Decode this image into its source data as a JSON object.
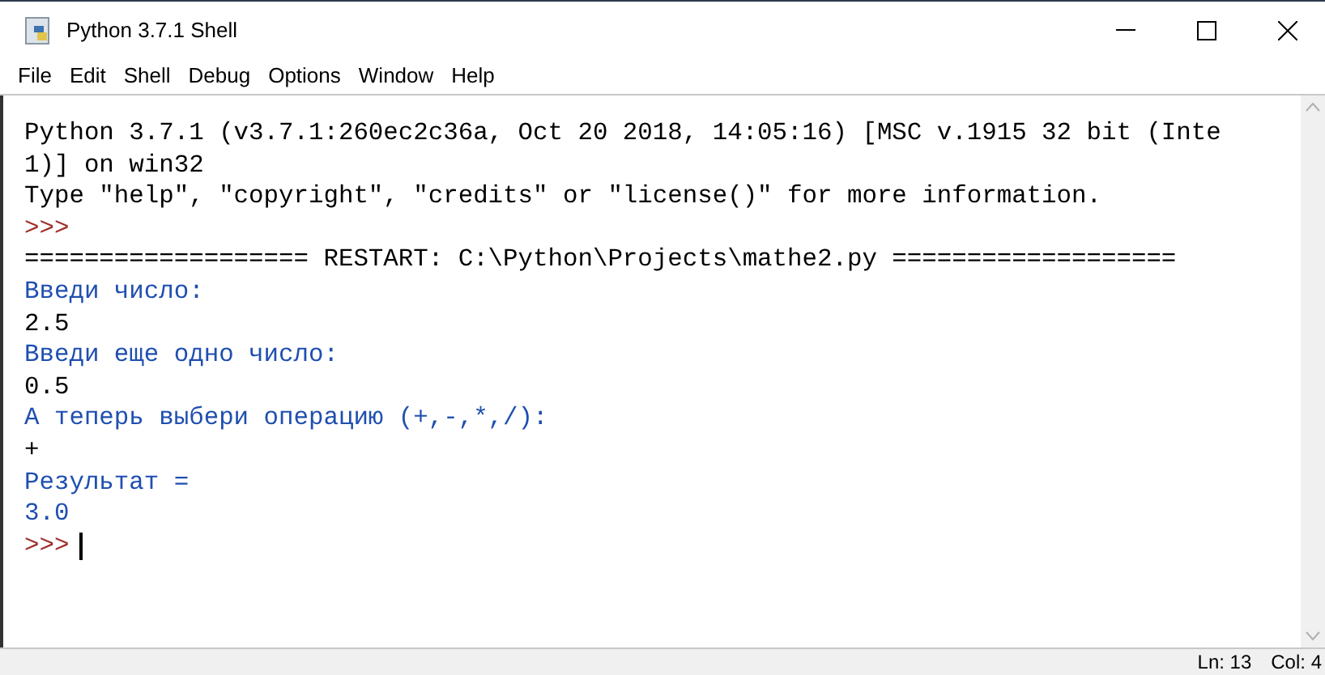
{
  "window": {
    "title": "Python 3.7.1 Shell"
  },
  "menu": [
    "File",
    "Edit",
    "Shell",
    "Debug",
    "Options",
    "Window",
    "Help"
  ],
  "lines": [
    {
      "kind": "output",
      "text": "Python 3.7.1 (v3.7.1:260ec2c36a, Oct 20 2018, 14:05:16) [MSC v.1915 32 bit (Inte"
    },
    {
      "kind": "output",
      "text": "1)] on win32"
    },
    {
      "kind": "output",
      "text": "Type \"help\", \"copyright\", \"credits\" or \"license()\" for more information."
    },
    {
      "kind": "prompt",
      "text": ">>>"
    },
    {
      "kind": "output",
      "text": "=================== RESTART: C:\\Python\\Projects\\mathe2.py ==================="
    },
    {
      "kind": "program",
      "text": "Введи число:"
    },
    {
      "kind": "input",
      "text": "2.5"
    },
    {
      "kind": "program",
      "text": "Введи еще одно число:"
    },
    {
      "kind": "input",
      "text": "0.5"
    },
    {
      "kind": "program",
      "text": "А теперь выбери операцию (+,-,*,/):"
    },
    {
      "kind": "input",
      "text": "+"
    },
    {
      "kind": "program",
      "text": "Результат ="
    },
    {
      "kind": "program",
      "text": "3.0"
    },
    {
      "kind": "prompt",
      "text": ">>>",
      "cursor": true
    }
  ],
  "status_bar": {
    "line": "Ln: 13",
    "column": "Col: 4"
  }
}
